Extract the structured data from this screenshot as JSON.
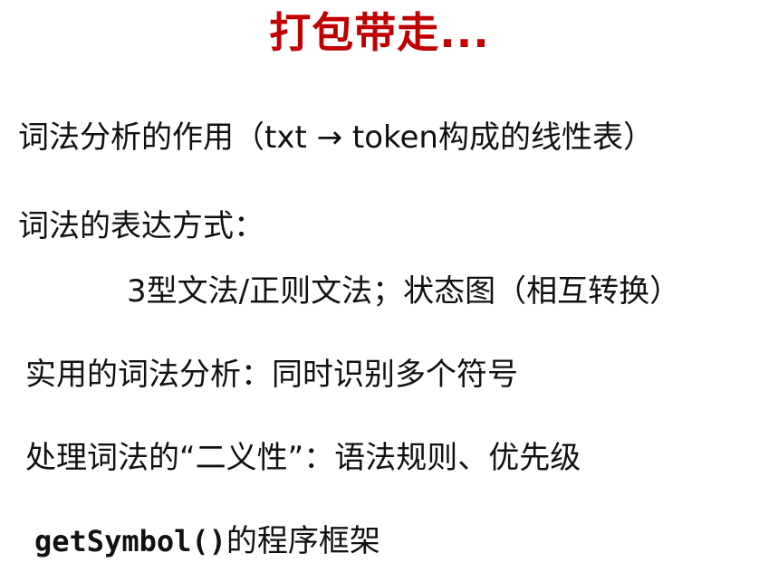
{
  "colors": {
    "title": "#c00000",
    "text": "#111111",
    "background": "#ffffff"
  },
  "slide": {
    "title": "打包带走...",
    "lines": [
      "词法分析的作用（txt → token构成的线性表）",
      "词法的表达方式：",
      "3型文法/正则文法；状态图（相互转换）",
      "实用的词法分析：同时识别多个符号",
      "处理词法的“二义性”：语法规则、优先级"
    ],
    "last_line": {
      "code": "getSymbol()",
      "text": "的程序框架"
    }
  }
}
